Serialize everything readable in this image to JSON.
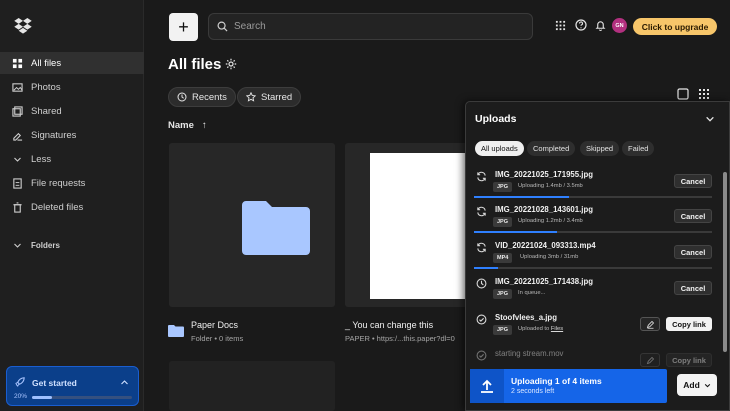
{
  "sidebar": {
    "items": [
      {
        "label": "All files",
        "icon": "folder-icon",
        "active": true
      },
      {
        "label": "Photos",
        "icon": "photo-icon"
      },
      {
        "label": "Shared",
        "icon": "shared-icon"
      },
      {
        "label": "Signatures",
        "icon": "signature-icon"
      },
      {
        "label": "Less",
        "icon": "chevron-up-icon"
      },
      {
        "label": "File requests",
        "icon": "file-request-icon"
      },
      {
        "label": "Deleted files",
        "icon": "trash-icon"
      }
    ],
    "folders_label": "Folders",
    "get_started": {
      "label": "Get started",
      "percent_label": "20%",
      "progress": 0.2
    }
  },
  "header": {
    "new_label": "+",
    "search_placeholder": "Search",
    "avatar_initials": "GN",
    "upgrade_label": "Click to upgrade"
  },
  "main": {
    "title": "All files",
    "chips": [
      {
        "label": "Recents",
        "icon": "clock-icon"
      },
      {
        "label": "Starred",
        "icon": "star-icon"
      }
    ],
    "sort_label": "Name",
    "sort_arrow": "↑",
    "cards": [
      {
        "name": "Paper Docs",
        "meta": "Folder • 0 items"
      },
      {
        "name": "_ You can change this",
        "meta": "PAPER • https:/...this.paper?dl=0"
      }
    ]
  },
  "uploads": {
    "title": "Uploads",
    "tabs": [
      "All uploads",
      "Completed",
      "Skipped",
      "Failed"
    ],
    "items": [
      {
        "name": "IMG_20221025_171955.jpg",
        "type": "JPG",
        "status": "Uploading 1.4mb / 3.5mb",
        "action": "Cancel",
        "progress": 0.4,
        "icon": "sync-icon"
      },
      {
        "name": "IMG_20221028_143601.jpg",
        "type": "JPG",
        "status": "Uploading 1.2mb / 3.4mb",
        "action": "Cancel",
        "progress": 0.35,
        "icon": "sync-icon"
      },
      {
        "name": "VID_20221024_093313.mp4",
        "type": "MP4",
        "status": "Uploading 3mb / 31mb",
        "action": "Cancel",
        "progress": 0.1,
        "icon": "sync-icon"
      },
      {
        "name": "IMG_20221025_171438.jpg",
        "type": "JPG",
        "status": "In queue...",
        "action": "Cancel",
        "icon": "clock-icon"
      },
      {
        "name": "Stoofvlees_a.jpg",
        "type": "JPG",
        "status": "Uploaded to",
        "status_link": "Files",
        "action": "Copy link",
        "icon": "check-circle-icon"
      },
      {
        "name": "starting stream.mov",
        "action": "Copy link",
        "icon": "check-circle-icon"
      }
    ],
    "footer": {
      "title": "Uploading 1 of 4 items",
      "subtitle": "2 seconds left",
      "add_label": "Add"
    }
  }
}
